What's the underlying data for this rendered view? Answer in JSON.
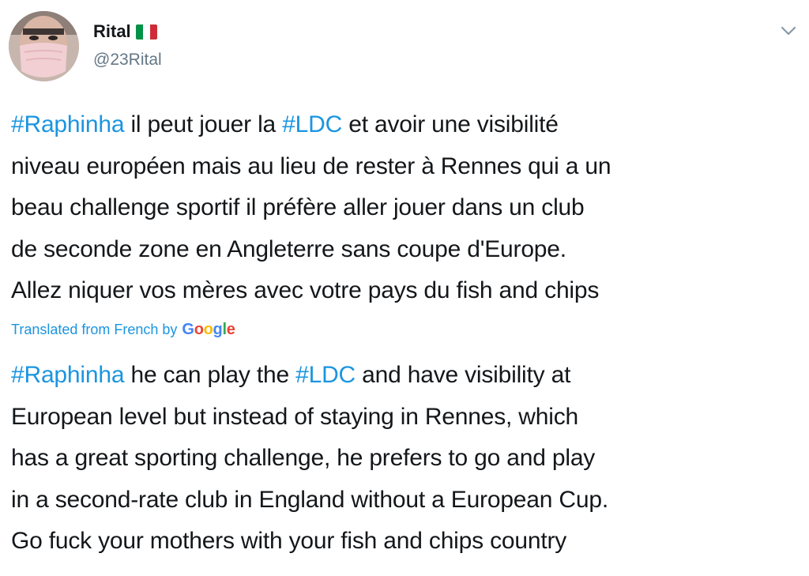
{
  "user": {
    "display_name": "Rital",
    "handle": "@23Rital",
    "flag_icon": "italy-flag-icon",
    "flag_colors": [
      "#009246",
      "#ffffff",
      "#ce2b37"
    ]
  },
  "menu": {
    "icon": "chevron-down-icon"
  },
  "original_text": {
    "lines": [
      [
        {
          "t": "#Raphinha",
          "tag": true
        },
        {
          "t": " il peut jouer la "
        },
        {
          "t": "#LDC",
          "tag": true
        },
        {
          "t": " et avoir une visibilité"
        }
      ],
      [
        {
          "t": "niveau européen mais au lieu de rester à Rennes qui a un"
        }
      ],
      [
        {
          "t": "beau challenge sportif il préfère aller jouer dans un club"
        }
      ],
      [
        {
          "t": "de seconde zone en Angleterre sans coupe d'Europe."
        }
      ],
      [
        {
          "t": "Allez niquer vos mères avec votre pays du fish and chips"
        }
      ]
    ]
  },
  "translation": {
    "note": "Translated from French by",
    "provider": "Google"
  },
  "translated_text": {
    "lines": [
      [
        {
          "t": "#Raphinha",
          "tag": true
        },
        {
          "t": " he can play the "
        },
        {
          "t": "#LDC",
          "tag": true
        },
        {
          "t": " and have visibility at"
        }
      ],
      [
        {
          "t": "European level but instead of staying in Rennes, which"
        }
      ],
      [
        {
          "t": "has a great sporting challenge, he prefers to go and play"
        }
      ],
      [
        {
          "t": "in a second-rate club in England without a European Cup."
        }
      ],
      [
        {
          "t": "Go fuck your mothers with your fish and chips country"
        }
      ]
    ]
  },
  "colors": {
    "link": "#1b95e0",
    "text": "#14171a",
    "secondary": "#657786"
  }
}
